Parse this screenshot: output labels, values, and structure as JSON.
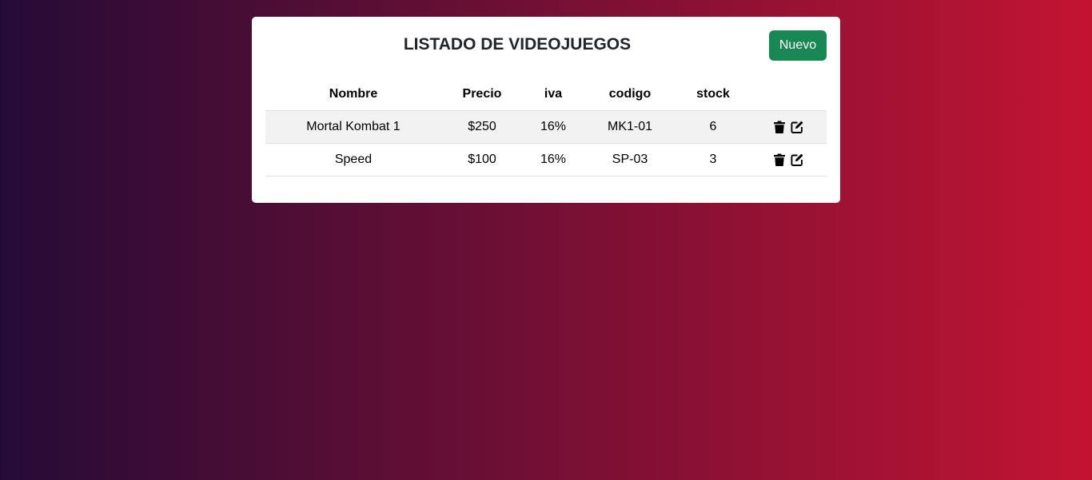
{
  "page": {
    "title": "LISTADO DE VIDEOJUEGOS",
    "new_button": "Nuevo"
  },
  "table": {
    "headers": [
      "Nombre",
      "Precio",
      "iva",
      "codigo",
      "stock",
      ""
    ],
    "rows": [
      {
        "nombre": "Mortal Kombat 1",
        "precio": "$250",
        "iva": "16%",
        "codigo": "MK1-01",
        "stock": "6",
        "actions": [
          "trash-icon",
          "edit-icon"
        ]
      },
      {
        "nombre": "Speed",
        "precio": "$100",
        "iva": "16%",
        "codigo": "SP-03",
        "stock": "3",
        "actions": [
          "trash-icon",
          "edit-icon"
        ]
      }
    ]
  },
  "colors": {
    "background_start": "#240b36",
    "background_end": "#c31432",
    "new_button": "#198754",
    "striped_row": "#f2f2f2"
  }
}
